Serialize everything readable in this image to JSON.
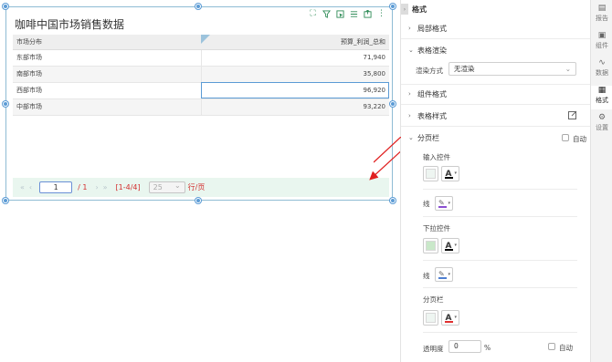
{
  "widget": {
    "title": "咖啡中国市场销售数据",
    "toolbar_icons": [
      "fullscreen-icon",
      "filter-icon",
      "select-icon",
      "list-icon",
      "export-icon",
      "more-icon"
    ]
  },
  "table": {
    "columns": [
      "市场分布",
      "预算_利润_总和"
    ],
    "rows": [
      {
        "market": "东部市场",
        "value": "71,940"
      },
      {
        "market": "南部市场",
        "value": "35,800"
      },
      {
        "market": "西部市场",
        "value": "96,920"
      },
      {
        "market": "中部市场",
        "value": "93,220"
      }
    ]
  },
  "pager": {
    "first": "«",
    "prev": "‹",
    "page": "1",
    "total": "/ 1",
    "next": "›",
    "last": "»",
    "range": "[1-4/4]",
    "page_size": "25",
    "per_page_label": "行/页"
  },
  "panel": {
    "tab_title": "格式",
    "sections": {
      "local_format": "局部格式",
      "table_render": "表格渲染",
      "render_mode_label": "渲染方式",
      "render_mode_value": "无渲染",
      "component_format": "组件格式",
      "table_style": "表格样式",
      "pager_bar": "分页栏",
      "auto_label": "自动",
      "input_control": "输入控件",
      "line_label_1": "线",
      "dropdown_control": "下拉控件",
      "line_label_2": "线",
      "pager_bar_sub": "分页栏",
      "opacity_label": "透明度",
      "opacity_value": "0",
      "opacity_unit": "%",
      "auto_label_2": "自动"
    },
    "colors": {
      "input_fill": "#eef5f1",
      "dropdown_fill": "#c9e8c9",
      "pager_fill": "#eef5f1",
      "font_black": "#000000",
      "font_red": "#e03030",
      "line_purple": "#8a4fd0",
      "line_blue": "#4f7fd0"
    }
  },
  "vtabs": [
    {
      "label": "报告",
      "icon": "report-icon"
    },
    {
      "label": "组件",
      "icon": "component-icon"
    },
    {
      "label": "数据",
      "icon": "data-icon"
    },
    {
      "label": "格式",
      "icon": "format-icon"
    },
    {
      "label": "设置",
      "icon": "settings-icon"
    }
  ]
}
